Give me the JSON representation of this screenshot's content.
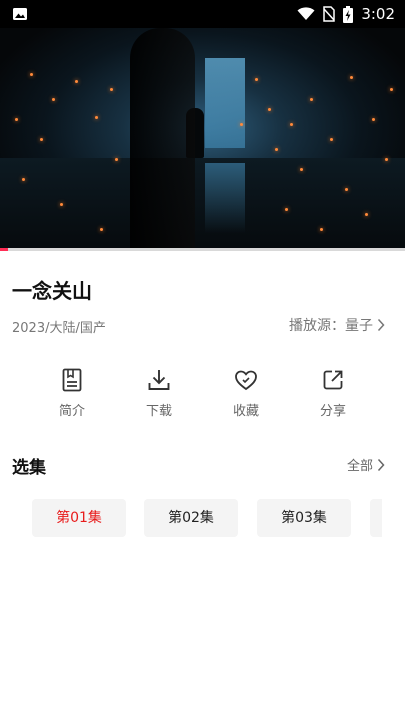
{
  "status_bar": {
    "time": "3:02",
    "icons": [
      "image-icon",
      "wifi-icon",
      "no-sim-icon",
      "battery-charging-icon"
    ]
  },
  "video": {
    "progress": 0.02,
    "accent_color": "#ff2d55"
  },
  "show": {
    "title": "一念关山",
    "meta": "2023/大陆/国产",
    "source_label": "播放源：量子"
  },
  "actions": [
    {
      "label": "简介",
      "icon": "intro-icon"
    },
    {
      "label": "下载",
      "icon": "download-icon"
    },
    {
      "label": "收藏",
      "icon": "favorite-icon"
    },
    {
      "label": "分享",
      "icon": "share-icon"
    }
  ],
  "episodes": {
    "title": "选集",
    "all_label": "全部",
    "items": [
      "第01集",
      "第02集",
      "第03集"
    ],
    "active_index": 0,
    "active_color": "#e81b1b"
  }
}
